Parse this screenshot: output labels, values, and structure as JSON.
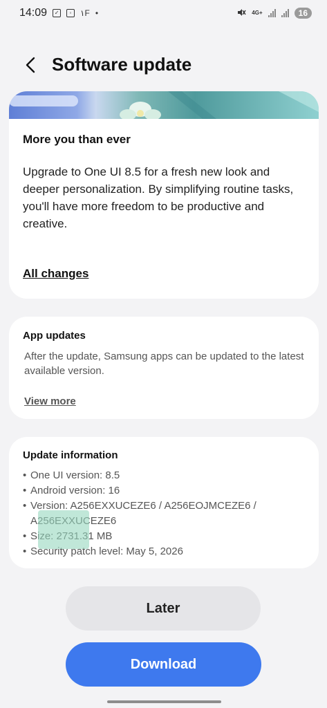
{
  "status_bar": {
    "time": "14:09",
    "left_icons": [
      "check-box-icon",
      "screenshot-icon",
      "network-speed-icon",
      "notification-dot-icon"
    ],
    "indicator_text": "۱F",
    "network_label": "4G+",
    "battery": "16"
  },
  "header": {
    "back_icon": "chevron-left-icon",
    "title": "Software update"
  },
  "whats_new": {
    "title": "More you than ever",
    "body": "Upgrade to One UI 8.5 for a fresh new look and deeper personalization. By simplifying routine tasks, you'll have more freedom to be productive and creative.",
    "link": "All changes"
  },
  "app_updates": {
    "title": "App updates",
    "body": "After the update, Samsung apps can be updated to the latest available version.",
    "link": "View more"
  },
  "update_information": {
    "title": "Update information",
    "items": [
      "One UI version: 8.5",
      "Android version: 16",
      "Version: A256EXXUCEZE6 / A256EOJMCEZE6 / A256EXXUCEZE6",
      "Size: 2731.31 MB",
      "Security patch level: May 5, 2026"
    ]
  },
  "buttons": {
    "later": "Later",
    "download": "Download"
  },
  "colors": {
    "background": "#f3f3f5",
    "card": "#ffffff",
    "download_button": "#3e79ee",
    "later_button": "#e5e5e8"
  }
}
